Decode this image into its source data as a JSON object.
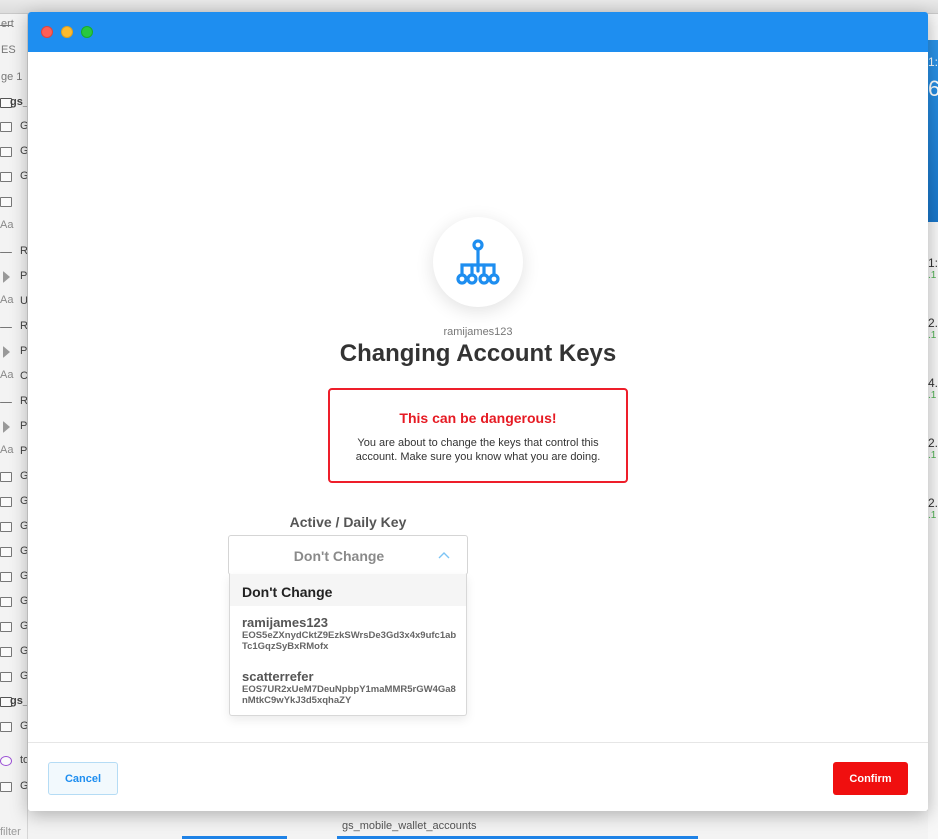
{
  "background": {
    "sidebar_rows": [
      {
        "icon": "line",
        "label": "ert",
        "style": "plain"
      },
      {
        "icon": "none",
        "label": "ES",
        "style": "plain"
      },
      {
        "icon": "none",
        "label": "ge 1",
        "style": "plain"
      },
      {
        "icon": "folder",
        "label": "gs_",
        "style": "bold"
      },
      {
        "icon": "folder",
        "label": "G",
        "style": "normal"
      },
      {
        "icon": "folder",
        "label": "G",
        "style": "normal"
      },
      {
        "icon": "folder",
        "label": "G",
        "style": "normal"
      },
      {
        "icon": "folder",
        "label": "",
        "style": "normal"
      },
      {
        "icon": "aa",
        "label": "",
        "style": "normal"
      },
      {
        "icon": "line",
        "label": "R",
        "style": "normal"
      },
      {
        "icon": "tri",
        "label": "P",
        "style": "normal"
      },
      {
        "icon": "aa",
        "label": "U",
        "style": "normal"
      },
      {
        "icon": "line",
        "label": "R",
        "style": "normal"
      },
      {
        "icon": "tri",
        "label": "P",
        "style": "normal"
      },
      {
        "icon": "aa",
        "label": "C",
        "style": "normal"
      },
      {
        "icon": "line",
        "label": "R",
        "style": "normal"
      },
      {
        "icon": "tri",
        "label": "P",
        "style": "normal"
      },
      {
        "icon": "aa",
        "label": "P",
        "style": "normal"
      },
      {
        "icon": "folder",
        "label": "G",
        "style": "normal"
      },
      {
        "icon": "folder",
        "label": "G",
        "style": "normal"
      },
      {
        "icon": "folder",
        "label": "G",
        "style": "normal"
      },
      {
        "icon": "folder",
        "label": "G",
        "style": "normal"
      },
      {
        "icon": "folder",
        "label": "G",
        "style": "normal"
      },
      {
        "icon": "folder",
        "label": "G",
        "style": "normal"
      },
      {
        "icon": "folder",
        "label": "G",
        "style": "normal"
      },
      {
        "icon": "folder",
        "label": "G",
        "style": "normal"
      },
      {
        "icon": "folder",
        "label": "G",
        "style": "normal"
      },
      {
        "icon": "folder",
        "label": "gs_",
        "style": "bold"
      },
      {
        "icon": "folder",
        "label": "G",
        "style": "normal"
      },
      {
        "icon": "purple",
        "label": "to",
        "style": "normal"
      },
      {
        "icon": "folder",
        "label": "G",
        "style": "normal"
      }
    ],
    "right_header": [
      "1:",
      "6"
    ],
    "right_values": [
      {
        "top": "1:",
        "sub": ".1"
      },
      {
        "top": "2.",
        "sub": ".1"
      },
      {
        "top": "4.",
        "sub": ".1"
      },
      {
        "top": "2.",
        "sub": ".1"
      },
      {
        "top": "2.",
        "sub": ".1"
      }
    ],
    "filter_text": "filter",
    "bottom_tab": "gs_mobile_wallet_accounts"
  },
  "modal": {
    "account_name": "ramijames123",
    "title": "Changing Account Keys",
    "warning": {
      "title": "This can be dangerous!",
      "text": "You are about to change the keys that control this account. Make sure you know what you are doing."
    },
    "key_field": {
      "label": "Active / Daily Key",
      "selected": "Don't Change",
      "options": [
        {
          "name": "Don't Change",
          "key": ""
        },
        {
          "name": "ramijames123",
          "key": "EOS5eZXnydCktZ9EzkSWrsDe3Gd3x4x9ufc1abTc1GqzSyBxRMofx"
        },
        {
          "name": "scatterrefer",
          "key": "EOS7UR2xUeM7DeuNpbpY1maMMR5rGW4Ga8nMtkC9wYkJ3d5xqhaZY"
        }
      ]
    },
    "buttons": {
      "cancel": "Cancel",
      "confirm": "Confirm"
    },
    "colors": {
      "titlebar": "#1e8ef0",
      "danger": "#ee1e2a",
      "accent": "#1e8ef0"
    },
    "icons": {
      "header": "key-hierarchy-icon",
      "dropdown": "chevron-up-icon"
    }
  }
}
